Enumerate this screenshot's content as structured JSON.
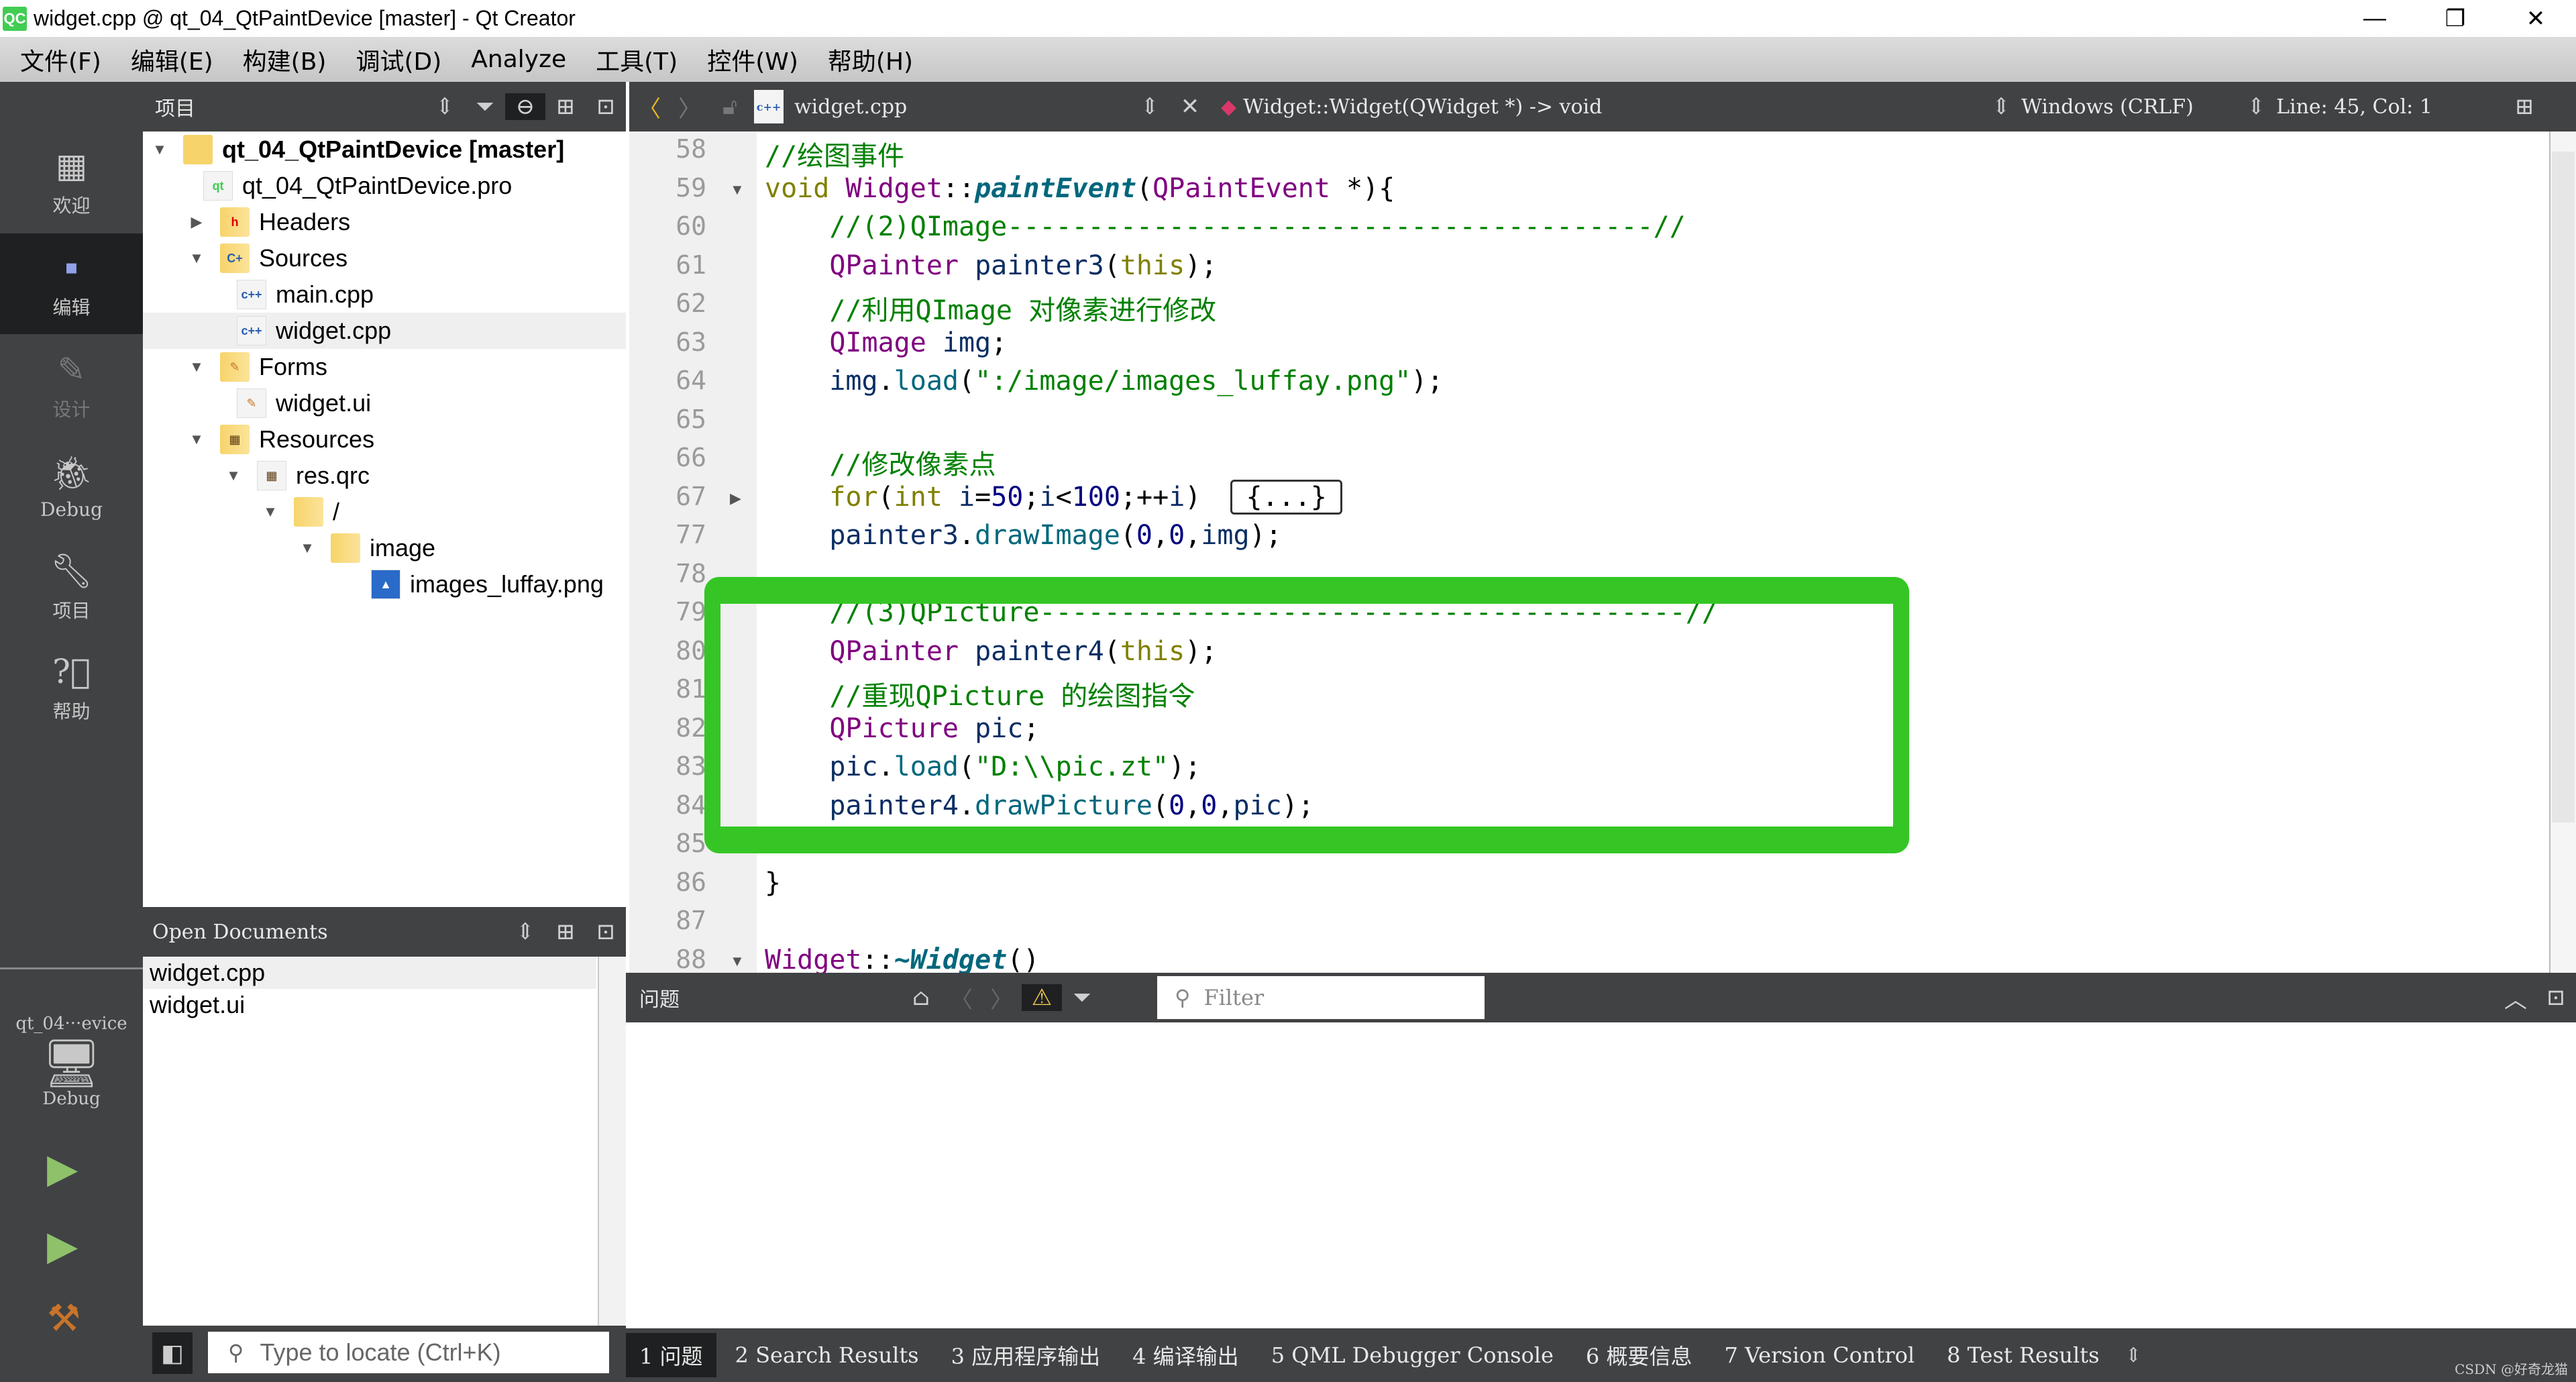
{
  "window": {
    "app_icon": "QC",
    "title": "widget.cpp @ qt_04_QtPaintDevice [master] - Qt Creator",
    "controls": [
      "minimize",
      "restore",
      "close"
    ]
  },
  "menu": [
    "文件(F)",
    "编辑(E)",
    "构建(B)",
    "调试(D)",
    "Analyze",
    "工具(T)",
    "控件(W)",
    "帮助(H)"
  ],
  "modes": [
    {
      "label": "欢迎",
      "icon": "grid-icon"
    },
    {
      "label": "编辑",
      "icon": "document-icon",
      "active": true
    },
    {
      "label": "设计",
      "icon": "pencil-icon",
      "disabled": true
    },
    {
      "label": "Debug",
      "icon": "bug-icon"
    },
    {
      "label": "项目",
      "icon": "wrench-icon"
    },
    {
      "label": "帮助",
      "icon": "help-icon"
    }
  ],
  "kit": {
    "project": "qt_04···evice",
    "build": "Debug"
  },
  "project_panel": {
    "title": "项目",
    "tree": [
      {
        "label": "qt_04_QtPaintDevice [master]",
        "depth": 0,
        "expanded": true,
        "bold": true,
        "icon": "qt-folder"
      },
      {
        "label": "qt_04_QtPaintDevice.pro",
        "depth": 1,
        "icon": "qt-file"
      },
      {
        "label": "Headers",
        "depth": 1,
        "expanded": false,
        "icon": "folder-h"
      },
      {
        "label": "Sources",
        "depth": 1,
        "expanded": true,
        "icon": "folder-cpp"
      },
      {
        "label": "main.cpp",
        "depth": 2,
        "icon": "cpp-file"
      },
      {
        "label": "widget.cpp",
        "depth": 2,
        "icon": "cpp-file",
        "selected": true
      },
      {
        "label": "Forms",
        "depth": 1,
        "expanded": true,
        "icon": "folder-ui"
      },
      {
        "label": "widget.ui",
        "depth": 2,
        "icon": "ui-file"
      },
      {
        "label": "Resources",
        "depth": 1,
        "expanded": true,
        "icon": "folder-res"
      },
      {
        "label": "res.qrc",
        "depth": 2,
        "expanded": true,
        "icon": "qrc-file"
      },
      {
        "label": "/",
        "depth": 3,
        "expanded": true,
        "icon": "folder"
      },
      {
        "label": "image",
        "depth": 4,
        "expanded": true,
        "icon": "folder"
      },
      {
        "label": "images_luffay.png",
        "depth": 5,
        "icon": "image-file"
      }
    ]
  },
  "open_documents": {
    "title": "Open Documents",
    "items": [
      "widget.cpp",
      "widget.ui"
    ]
  },
  "locator": {
    "placeholder": "Type to locate (Ctrl+K)"
  },
  "editor_toolbar": {
    "file": "widget.cpp",
    "symbol": "Widget::Widget(QWidget *) -> void",
    "line_endings": "Windows (CRLF)",
    "position": "Line: 45, Col: 1"
  },
  "code_lines": [
    {
      "n": "58",
      "text": "//绘图事件"
    },
    {
      "n": "59",
      "text": "void Widget::paintEvent(QPaintEvent *){",
      "fold": "open"
    },
    {
      "n": "60",
      "text": "    //(2)QImage----------------------------------------//"
    },
    {
      "n": "61",
      "text": "    QPainter painter3(this);"
    },
    {
      "n": "62",
      "text": "    //利用QImage 对像素进行修改"
    },
    {
      "n": "63",
      "text": "    QImage img;"
    },
    {
      "n": "64",
      "text": "    img.load(\":/image/images_luffay.png\");"
    },
    {
      "n": "65",
      "text": ""
    },
    {
      "n": "66",
      "text": "    //修改像素点"
    },
    {
      "n": "67",
      "text": "    for(int i=50;i<100;++i) {...}",
      "fold": "closed"
    },
    {
      "n": "77",
      "text": "    painter3.drawImage(0,0,img);"
    },
    {
      "n": "78",
      "text": ""
    },
    {
      "n": "79",
      "text": "    //(3)QPicture----------------------------------------//"
    },
    {
      "n": "80",
      "text": "    QPainter painter4(this);"
    },
    {
      "n": "81",
      "text": "    //重现QPicture 的绘图指令"
    },
    {
      "n": "82",
      "text": "    QPicture pic;"
    },
    {
      "n": "83",
      "text": "    pic.load(\"D:\\\\pic.zt\");"
    },
    {
      "n": "84",
      "text": "    painter4.drawPicture(0,0,pic);"
    },
    {
      "n": "85",
      "text": ""
    },
    {
      "n": "86",
      "text": "}"
    },
    {
      "n": "87",
      "text": ""
    },
    {
      "n": "88",
      "text": "Widget::~Widget()",
      "fold": "open"
    }
  ],
  "annotation": {
    "color": "#35c625",
    "shape": "rounded-rectangle"
  },
  "output_pane": {
    "title": "问题",
    "filter_placeholder": "Filter"
  },
  "output_tabs": [
    {
      "n": "1",
      "label": "问题",
      "active": true
    },
    {
      "n": "2",
      "label": "Search Results"
    },
    {
      "n": "3",
      "label": "应用程序输出"
    },
    {
      "n": "4",
      "label": "编译输出"
    },
    {
      "n": "5",
      "label": "QML Debugger Console"
    },
    {
      "n": "6",
      "label": "概要信息"
    },
    {
      "n": "7",
      "label": "Version Control"
    },
    {
      "n": "8",
      "label": "Test Results"
    }
  ],
  "watermark": "CSDN @好奇龙猫"
}
